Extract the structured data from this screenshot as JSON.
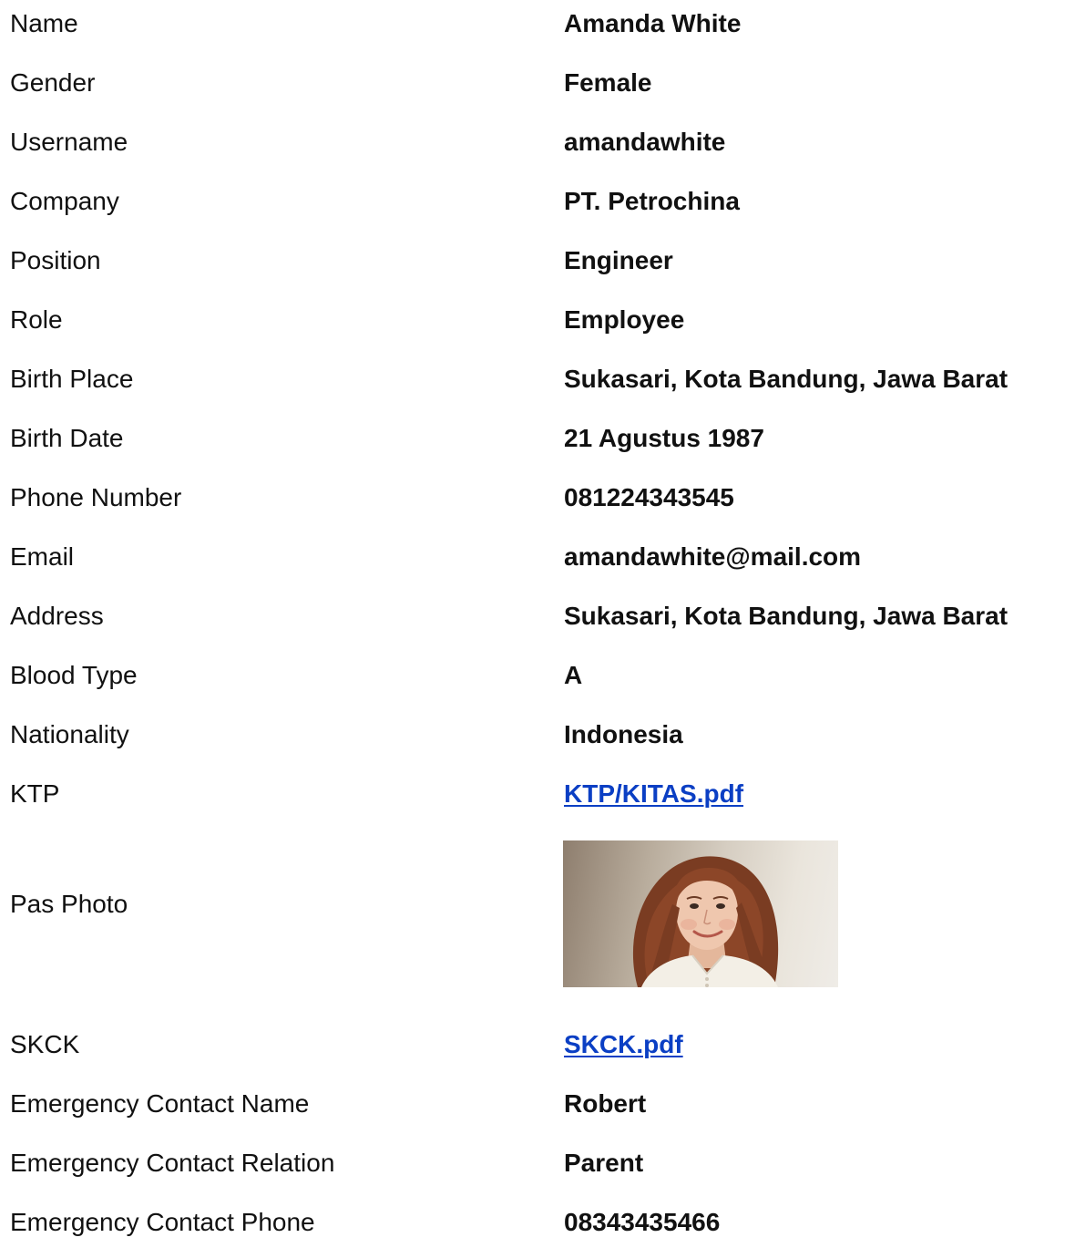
{
  "profile": {
    "rows": [
      {
        "label": "Name",
        "value": "Amanda White"
      },
      {
        "label": "Gender",
        "value": "Female"
      },
      {
        "label": "Username",
        "value": "amandawhite"
      },
      {
        "label": "Company",
        "value": "PT. Petrochina"
      },
      {
        "label": "Position",
        "value": "Engineer"
      },
      {
        "label": "Role",
        "value": "Employee"
      },
      {
        "label": "Birth Place",
        "value": "Sukasari, Kota Bandung, Jawa Barat"
      },
      {
        "label": "Birth Date",
        "value": "21 Agustus 1987"
      },
      {
        "label": "Phone Number",
        "value": "081224343545"
      },
      {
        "label": "Email",
        "value": "amandawhite@mail.com"
      },
      {
        "label": "Address",
        "value": "Sukasari, Kota Bandung, Jawa Barat"
      },
      {
        "label": "Blood Type",
        "value": "A"
      },
      {
        "label": "Nationality",
        "value": "Indonesia"
      },
      {
        "label": "KTP",
        "value": "KTP/KITAS.pdf"
      },
      {
        "label": "Pas Photo"
      },
      {
        "label": "SKCK",
        "value": "SKCK.pdf"
      },
      {
        "label": "Emergency Contact Name",
        "value": "Robert"
      },
      {
        "label": "Emergency Contact Relation",
        "value": "Parent"
      },
      {
        "label": "Emergency Contact Phone",
        "value": "08343435466"
      }
    ]
  },
  "colors": {
    "link": "#0b3fc4",
    "text": "#111111",
    "background": "#ffffff"
  }
}
